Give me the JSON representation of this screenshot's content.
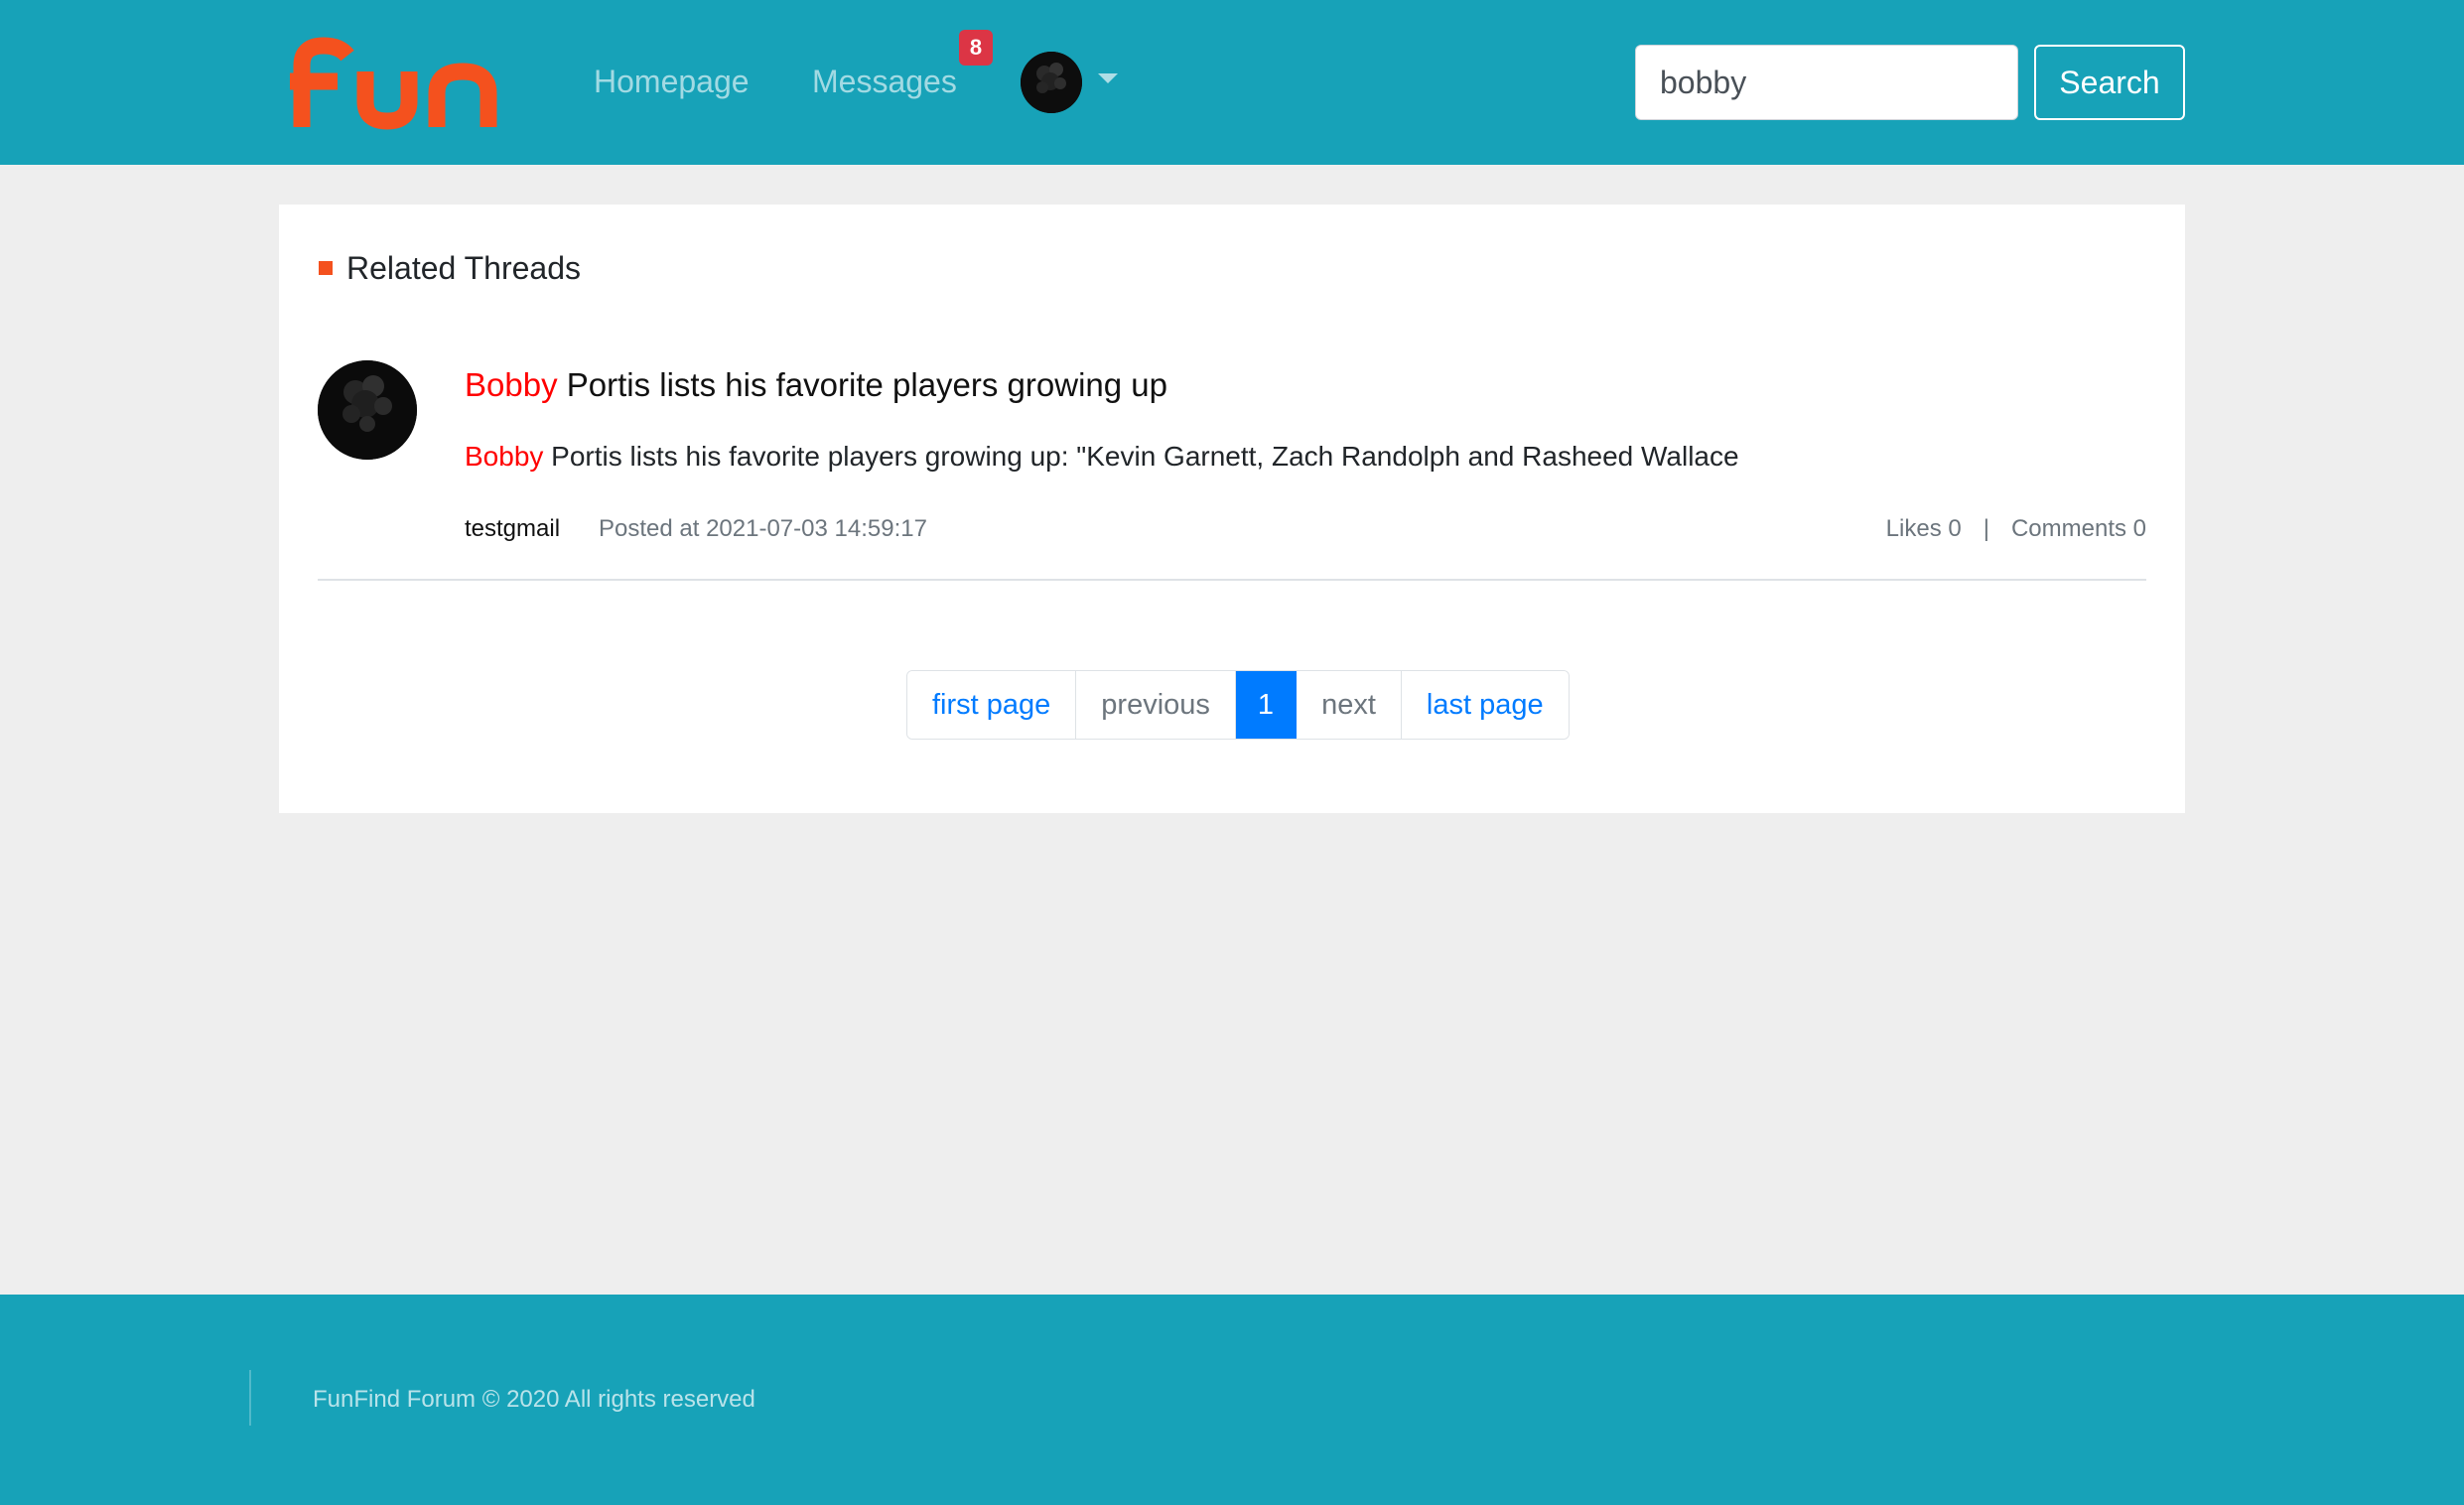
{
  "header": {
    "logo_text": "fun",
    "nav": {
      "home": "Homepage",
      "messages": "Messages",
      "messages_badge": "8"
    },
    "search": {
      "value": "bobby",
      "button": "Search"
    }
  },
  "main": {
    "section_title": "Related Threads",
    "threads": [
      {
        "title_highlight": "Bobby",
        "title_rest": " Portis lists his favorite players growing up",
        "body_highlight": "Bobby",
        "body_rest": " Portis lists his favorite players growing up: \"Kevin Garnett, Zach Randolph and Rasheed Wallace",
        "author": "testgmail",
        "posted": "Posted at 2021-07-03 14:59:17",
        "likes": "Likes 0",
        "separator": "|",
        "comments": "Comments 0"
      }
    ],
    "pagination": {
      "first": "first page",
      "previous": "previous",
      "current": "1",
      "next": "next",
      "last": "last page"
    }
  },
  "footer": {
    "text": "FunFind Forum © 2020 All rights reserved"
  },
  "colors": {
    "header_bg": "#17a2b8",
    "logo": "#f4511e",
    "highlight": "#ff0000",
    "page_active": "#007bff",
    "badge": "#dc3545"
  }
}
